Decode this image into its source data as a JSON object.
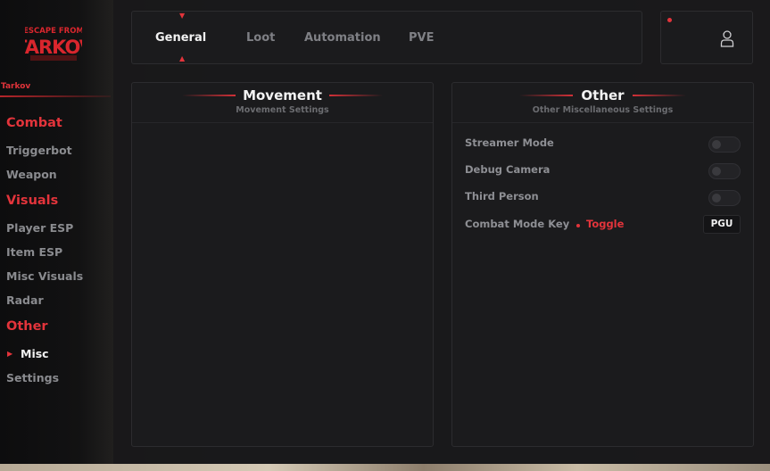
{
  "brand": {
    "logo_text": "ESCAPE FROM TARKOV",
    "game_label": "Tarkov",
    "accent": "#e3343b"
  },
  "sidebar": {
    "sections": [
      {
        "category": "Combat",
        "items": [
          "Triggerbot",
          "Weapon"
        ]
      },
      {
        "category": "Visuals",
        "items": [
          "Player ESP",
          "Item ESP",
          "Misc Visuals",
          "Radar"
        ]
      },
      {
        "category": "Other",
        "items": [
          "Misc",
          "Settings"
        ]
      }
    ],
    "active_item": "Misc"
  },
  "tabs": [
    {
      "label": "General",
      "active": true
    },
    {
      "label": "Loot",
      "active": false
    },
    {
      "label": "Automation",
      "active": false
    },
    {
      "label": "PVE",
      "active": false
    }
  ],
  "header": {
    "user_icon": "user-icon",
    "notification_dot": true
  },
  "movement_card": {
    "title": "Movement",
    "subtitle": "Movement Settings"
  },
  "other_card": {
    "title": "Other",
    "subtitle": "Other Miscellaneous Settings",
    "toggles": [
      {
        "label": "Streamer Mode",
        "enabled": false
      },
      {
        "label": "Debug Camera",
        "enabled": false
      },
      {
        "label": "Third Person",
        "enabled": false
      }
    ],
    "combat_mode": {
      "label": "Combat Mode Key",
      "mode": "Toggle",
      "key": "PGU"
    }
  }
}
